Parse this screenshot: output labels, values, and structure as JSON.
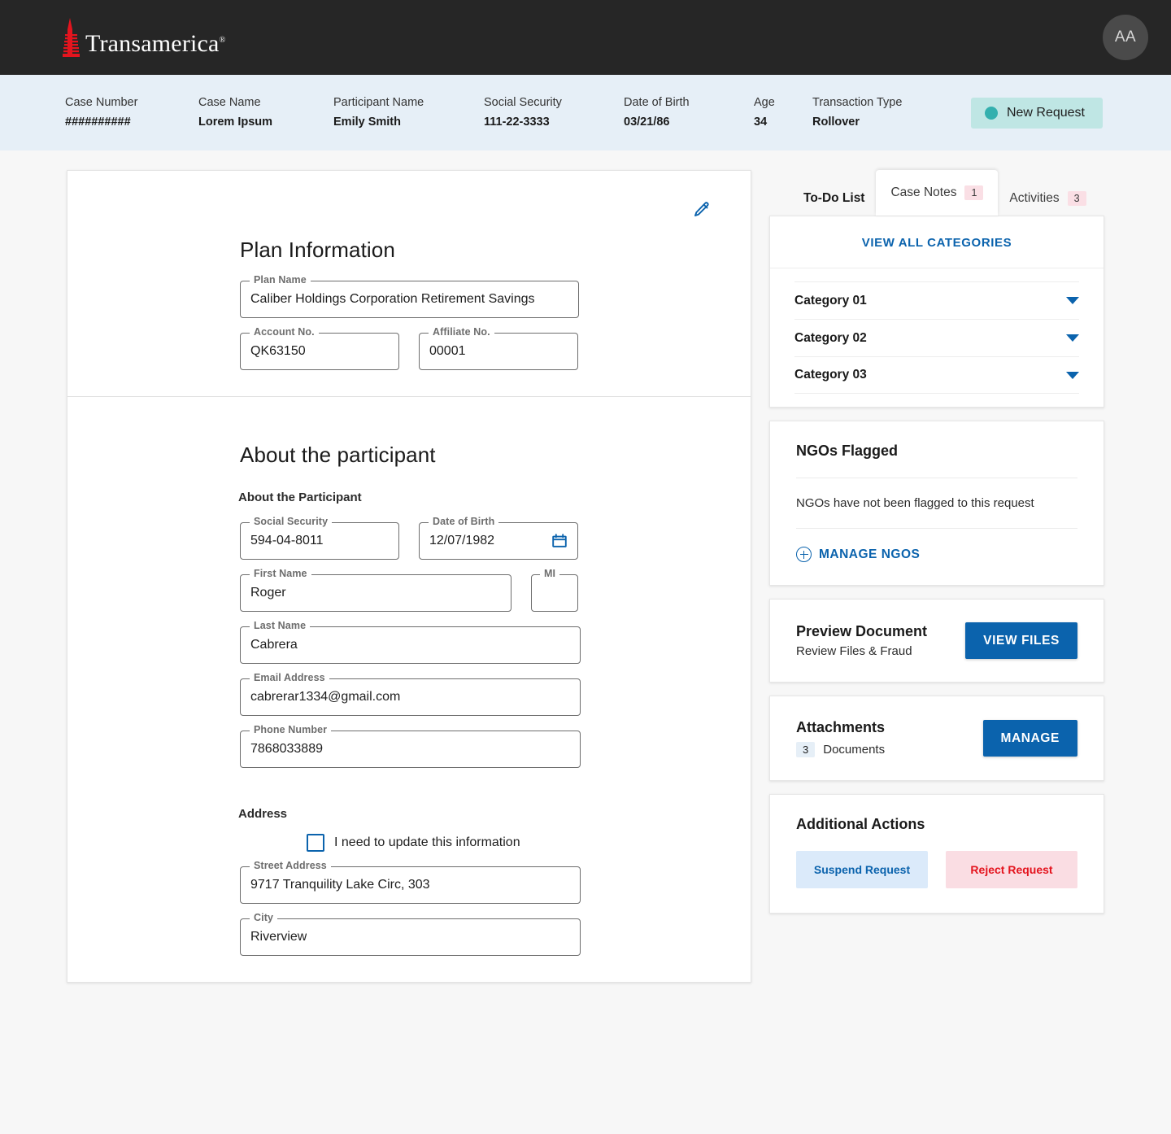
{
  "brand": {
    "name": "Transamerica",
    "registered_mark": "®",
    "logo_color": "#e4141e",
    "nav_background": "#262626"
  },
  "topnav": {
    "avatar_initials": "AA"
  },
  "case_bar": {
    "background": "#e6eff7",
    "fields": [
      {
        "label": "Case Number",
        "value": "##########"
      },
      {
        "label": "Case Name",
        "value": "Lorem Ipsum"
      },
      {
        "label": "Participant Name",
        "value": "Emily Smith"
      },
      {
        "label": "Social Security",
        "value": "111-22-3333"
      },
      {
        "label": "Date of Birth",
        "value": "03/21/86"
      },
      {
        "label": "Age",
        "value": "34"
      },
      {
        "label": "Transaction Type",
        "value": "Rollover"
      }
    ],
    "status": {
      "text": "New Request",
      "dot_color": "#34b0ae",
      "pill_color": "#bfe6e4"
    }
  },
  "plan_information": {
    "title": "Plan Information",
    "edit_icon": "pencil-icon",
    "fields": [
      {
        "label": "Plan Name",
        "value": "Caliber Holdings Corporation Retirement Savings"
      },
      {
        "label": "Account No.",
        "value": "QK63150"
      },
      {
        "label": "Affiliate No.",
        "value": "00001"
      }
    ]
  },
  "participant": {
    "title": "About the participant",
    "subheading": "About the Participant",
    "fields": [
      {
        "label": "Social Security",
        "value": "594-04-8011"
      },
      {
        "label": "Date of Birth",
        "value": "12/07/1982"
      },
      {
        "label": "First Name",
        "value": "Roger"
      },
      {
        "label": "MI",
        "value": ""
      },
      {
        "label": "Last Name",
        "value": "Cabrera"
      },
      {
        "label": "Email Address",
        "value": "cabrerar1334@gmail.com"
      },
      {
        "label": "Phone Number",
        "value": "7868033889"
      }
    ],
    "address": {
      "heading": "Address",
      "update_checkbox_label": "I need to update this information",
      "update_checkbox_checked": false,
      "fields": [
        {
          "label": "Street Address",
          "value": "9717 Tranquility Lake Circ, 303"
        },
        {
          "label": "City",
          "value": "Riverview"
        }
      ]
    }
  },
  "sidebar": {
    "tabs": [
      {
        "label": "To-Do List",
        "badge": "",
        "active": true,
        "raised": false
      },
      {
        "label": "Case Notes",
        "badge": "1",
        "active": false,
        "raised": true
      },
      {
        "label": "Activities",
        "badge": "3",
        "active": false,
        "raised": false
      }
    ],
    "categories_card": {
      "view_all_label": "VIEW ALL CATEGORIES",
      "items": [
        {
          "label": "Category 01"
        },
        {
          "label": "Category 02"
        },
        {
          "label": "Category 03"
        }
      ]
    },
    "ngos_card": {
      "title": "NGOs Flagged",
      "note": "NGOs have not been flagged to this request",
      "action_label": "MANAGE NGOS"
    },
    "preview_card": {
      "title": "Preview Document",
      "subtitle": "Review Files & Fraud",
      "button_label": "VIEW FILES"
    },
    "attachments_card": {
      "title": "Attachments",
      "count": "3",
      "count_label": "Documents",
      "button_label": "MANAGE"
    },
    "additional_actions_card": {
      "title": "Additional Actions",
      "suspend_label": "Suspend Request",
      "reject_label": "Reject Request",
      "suspend_color": "#0b63ad",
      "reject_color": "#e4141e"
    }
  }
}
